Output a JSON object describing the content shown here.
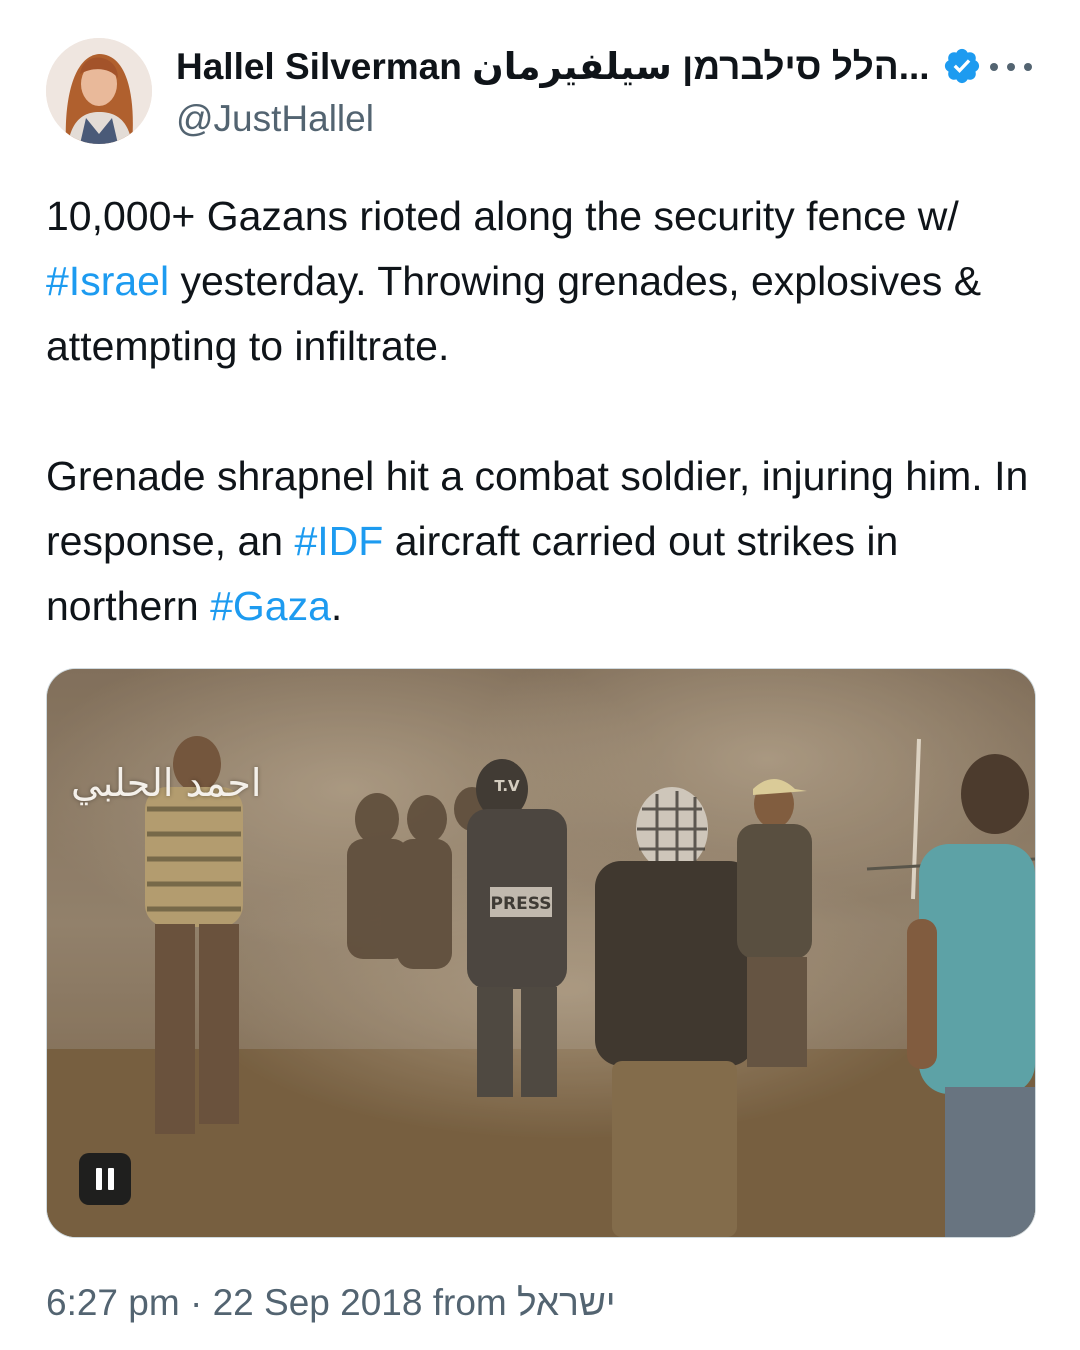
{
  "author": {
    "display_name": "Hallel Silverman הלל סילברמן سيلفيرمان...",
    "handle": "@JustHallel",
    "verified": true
  },
  "tweet": {
    "paragraph1": {
      "part1": "10,000+ Gazans rioted along the security fence w/ ",
      "tag1": "#Israel",
      "part2": " yesterday. Throwing grenades, explosives & attempting to infiltrate."
    },
    "paragraph2": {
      "part1": "Grenade shrapnel hit a combat soldier, injuring him. In response, an ",
      "tag1": "#IDF",
      "part2": " aircraft carried out strikes in northern ",
      "tag2": "#Gaza",
      "part3": "."
    }
  },
  "media": {
    "watermark": "احمد الحلبي",
    "tv_label": "T.V",
    "press_label": "PRESS",
    "playback_state": "playing"
  },
  "meta": {
    "time": "6:27 pm",
    "separator": " · ",
    "date": "22 Sep 2018",
    "from_label": " from ",
    "location": "ישראל"
  },
  "icons": {
    "verified": "verified-badge-icon",
    "more": "more-options-icon",
    "pause": "pause-icon"
  },
  "colors": {
    "link": "#1d9bf0",
    "text": "#0f1419",
    "secondary": "#536471",
    "verified": "#1d9bf0"
  }
}
